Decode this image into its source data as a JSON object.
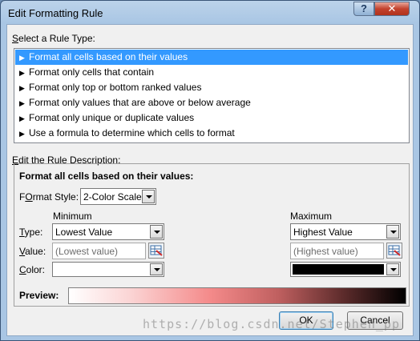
{
  "window": {
    "title": "Edit Formatting Rule",
    "help_label": "?",
    "close_label": "✕"
  },
  "rule_type": {
    "label_prefix": "",
    "label_hotkey": "S",
    "label_rest": "elect a Rule Type:",
    "items": [
      {
        "label": "Format all cells based on their values",
        "selected": true
      },
      {
        "label": "Format only cells that contain",
        "selected": false
      },
      {
        "label": "Format only top or bottom ranked values",
        "selected": false
      },
      {
        "label": "Format only values that are above or below average",
        "selected": false
      },
      {
        "label": "Format only unique or duplicate values",
        "selected": false
      },
      {
        "label": "Use a formula to determine which cells to format",
        "selected": false
      }
    ]
  },
  "description": {
    "label_prefix": "",
    "label_hotkey": "E",
    "label_rest": "dit the Rule Description:",
    "heading": "Format all cells based on their values:",
    "format_style_label_hotkey": "O",
    "format_style_label_pre": "F",
    "format_style_label_rest": "rmat Style:",
    "format_style_value": "2-Color Scale",
    "minimum_header": "Minimum",
    "maximum_header": "Maximum",
    "type_label_hotkey": "T",
    "type_label_rest": "ype:",
    "value_label_hotkey": "V",
    "value_label_rest": "alue:",
    "color_label_hotkey": "C",
    "color_label_rest": "olor:",
    "min_type": "Lowest Value",
    "min_value": "(Lowest value)",
    "min_color": "#ffffff",
    "max_type": "Highest Value",
    "max_value": "(Highest value)",
    "max_color": "#000000",
    "preview_label": "Preview:"
  },
  "buttons": {
    "ok": "OK",
    "cancel": "Cancel"
  },
  "watermark": "https://blog.csdn.net/Stephen_pp"
}
